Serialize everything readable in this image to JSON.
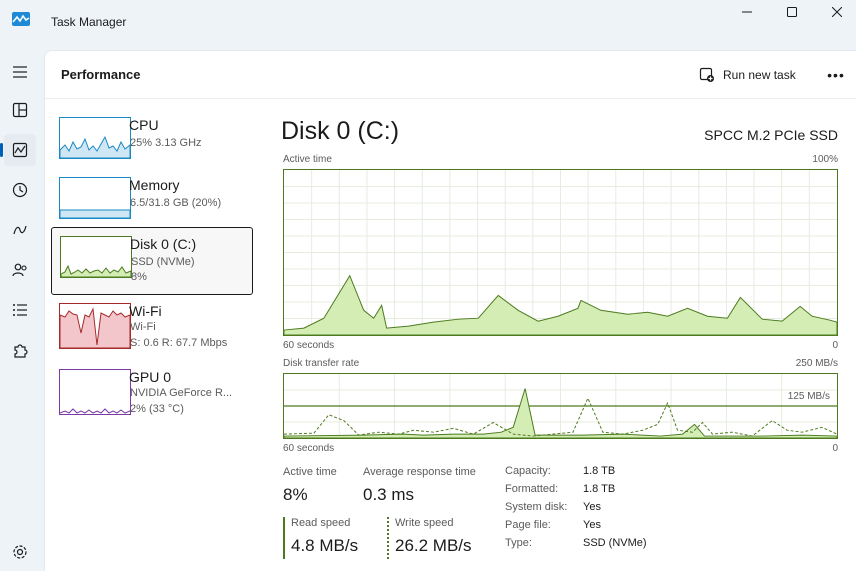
{
  "window": {
    "title": "Task Manager"
  },
  "nav": {
    "items": [
      "hamburger-menu-icon",
      "processes-icon",
      "performance-icon",
      "app-history-icon",
      "startup-apps-icon",
      "users-icon",
      "details-icon",
      "services-icon"
    ],
    "settings": "settings-icon"
  },
  "header": {
    "title": "Performance",
    "run_new_task": "Run new task",
    "more": "•••"
  },
  "devices": [
    {
      "name": "CPU",
      "line1": "25%  3.13 GHz",
      "line2": ""
    },
    {
      "name": "Memory",
      "line1": "6.5/31.8 GB (20%)",
      "line2": ""
    },
    {
      "name": "Disk 0 (C:)",
      "line1": "SSD (NVMe)",
      "line2": "8%"
    },
    {
      "name": "Wi-Fi",
      "line1": "Wi-Fi",
      "line2": "S: 0.6  R: 67.7 Mbps"
    },
    {
      "name": "GPU 0",
      "line1": "NVIDIA GeForce R...",
      "line2": "2%  (33 °C)"
    }
  ],
  "detail": {
    "title": "Disk 0 (C:)",
    "model": "SPCC M.2 PCIe SSD",
    "active_time_label": "Active time",
    "active_time_max": "100%",
    "active_time_xlabel": "60 seconds",
    "active_time_min": "0",
    "transfer_label": "Disk transfer rate",
    "transfer_max": "250 MB/s",
    "transfer_mid": "125 MB/s",
    "transfer_xlabel": "60 seconds",
    "transfer_min": "0"
  },
  "stats": {
    "active_time_label": "Active time",
    "active_time_value": "8%",
    "avg_response_label": "Average response time",
    "avg_response_value": "0.3 ms",
    "read_label": "Read speed",
    "read_value": "4.8 MB/s",
    "write_label": "Write speed",
    "write_value": "26.2 MB/s"
  },
  "properties": [
    {
      "label": "Capacity:",
      "value": "1.8 TB"
    },
    {
      "label": "Formatted:",
      "value": "1.8 TB"
    },
    {
      "label": "System disk:",
      "value": "Yes"
    },
    {
      "label": "Page file:",
      "value": "Yes"
    },
    {
      "label": "Type:",
      "value": "SSD (NVMe)"
    }
  ],
  "colors": {
    "disk_accent": "#4d7a1e",
    "disk_fill": "#d3edb4",
    "cpu_accent": "#1a89c4",
    "memory_accent": "#6a3a9c",
    "wifi_accent": "#a52a2a",
    "wifi_fill": "#f3c6cc",
    "gpu_accent": "#7a3aa8",
    "nav_active": "#005fb8"
  }
}
